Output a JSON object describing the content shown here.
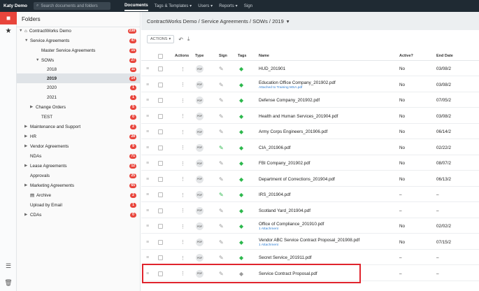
{
  "topnav": {
    "user": "Katy Demo",
    "search_placeholder": "Search documents and folders",
    "links": [
      "Documents",
      "Tags & Templates ▾",
      "Users ▾",
      "Reports ▾",
      "Sign"
    ]
  },
  "folders": {
    "title": "Folders",
    "tree": [
      {
        "label": "ContractWorks Demo",
        "badge": "238",
        "arrow": "▼",
        "icon": "home-icon"
      },
      {
        "label": "Service Agreements",
        "badge": "47",
        "arrow": "▼"
      },
      {
        "label": "Master Service Agreements",
        "badge": "15",
        "arrow": ""
      },
      {
        "label": "SOWs",
        "badge": "27",
        "arrow": "▼"
      },
      {
        "label": "2018",
        "badge": "11",
        "arrow": ""
      },
      {
        "label": "2019",
        "badge": "14",
        "arrow": ""
      },
      {
        "label": "2020",
        "badge": "1",
        "arrow": ""
      },
      {
        "label": "2021",
        "badge": "1",
        "arrow": ""
      },
      {
        "label": "Change Orders",
        "badge": "5",
        "arrow": "▶"
      },
      {
        "label": "TEST",
        "badge": "0",
        "arrow": ""
      },
      {
        "label": "Maintenance and Support",
        "badge": "2",
        "arrow": "▶"
      },
      {
        "label": "HR",
        "badge": "28",
        "arrow": "▶"
      },
      {
        "label": "Vendor Agreements",
        "badge": "9",
        "arrow": "▶"
      },
      {
        "label": "NDAs",
        "badge": "71",
        "arrow": ""
      },
      {
        "label": "Lease Agreements",
        "badge": "12",
        "arrow": "▶"
      },
      {
        "label": "Approvals",
        "badge": "25",
        "arrow": ""
      },
      {
        "label": "Marketing Agreements",
        "badge": "65",
        "arrow": "▶"
      },
      {
        "label": "Archive",
        "badge": "2",
        "arrow": "",
        "icon": "archive-icon"
      },
      {
        "label": "Upload by Email",
        "badge": "1",
        "arrow": ""
      },
      {
        "label": "CDAs",
        "badge": "0",
        "arrow": "▶"
      }
    ]
  },
  "breadcrumb": "ContractWorks Demo / Service Agreements / SOWs / 2019",
  "toolbar": {
    "actions_label": "ACTIONS"
  },
  "table": {
    "headers": [
      "Actions",
      "Type",
      "Sign",
      "Tags",
      "Name",
      "Active?",
      "End Date"
    ],
    "rows": [
      {
        "name": "HUD_201901",
        "sub": "",
        "active": "No",
        "end": "03/08/2",
        "pen": "grey",
        "tag": "green"
      },
      {
        "name": "Education Office Company_201902.pdf",
        "sub": "Attached to Training MSA.pdf",
        "active": "No",
        "end": "03/08/2",
        "pen": "grey",
        "tag": "green"
      },
      {
        "name": "Defense Company_201902.pdf",
        "sub": "",
        "active": "No",
        "end": "07/05/2",
        "pen": "grey",
        "tag": "green"
      },
      {
        "name": "Health and Human Services_201904.pdf",
        "sub": "",
        "active": "No",
        "end": "03/08/2",
        "pen": "grey",
        "tag": "green"
      },
      {
        "name": "Army Corps Engineers_201906.pdf",
        "sub": "",
        "active": "No",
        "end": "06/14/2",
        "pen": "grey",
        "tag": "green"
      },
      {
        "name": "CIA_201906.pdf",
        "sub": "",
        "active": "No",
        "end": "02/22/2",
        "pen": "green",
        "tag": "green"
      },
      {
        "name": "FBI Company_201902.pdf",
        "sub": "",
        "active": "No",
        "end": "08/07/2",
        "pen": "grey",
        "tag": "green"
      },
      {
        "name": "Department of Corrections_201904.pdf",
        "sub": "",
        "active": "No",
        "end": "06/13/2",
        "pen": "grey",
        "tag": "green"
      },
      {
        "name": "IRS_201904.pdf",
        "sub": "",
        "active": "–",
        "end": "–",
        "pen": "green",
        "tag": "green"
      },
      {
        "name": "Scotland Yard_201904.pdf",
        "sub": "",
        "active": "–",
        "end": "–",
        "pen": "grey",
        "tag": "green"
      },
      {
        "name": "Office of Compliance_201910.pdf",
        "sub": "1 Attachment",
        "active": "No",
        "end": "02/02/2",
        "pen": "grey",
        "tag": "green"
      },
      {
        "name": "Vendor ABC Service Contract Proposal_201908.pdf",
        "sub": "1 Attachment",
        "active": "No",
        "end": "07/15/2",
        "pen": "grey",
        "tag": "green"
      },
      {
        "name": "Secret Service_201911.pdf",
        "sub": "",
        "active": "–",
        "end": "–",
        "pen": "grey",
        "tag": "green"
      },
      {
        "name": "Service Contract Proposal.pdf",
        "sub": "",
        "active": "–",
        "end": "–",
        "pen": "grey",
        "tag": "grey"
      }
    ]
  },
  "colors": {
    "accent": "#e8453c",
    "highlight": "#e0242d",
    "tag_green": "#2db84d"
  }
}
